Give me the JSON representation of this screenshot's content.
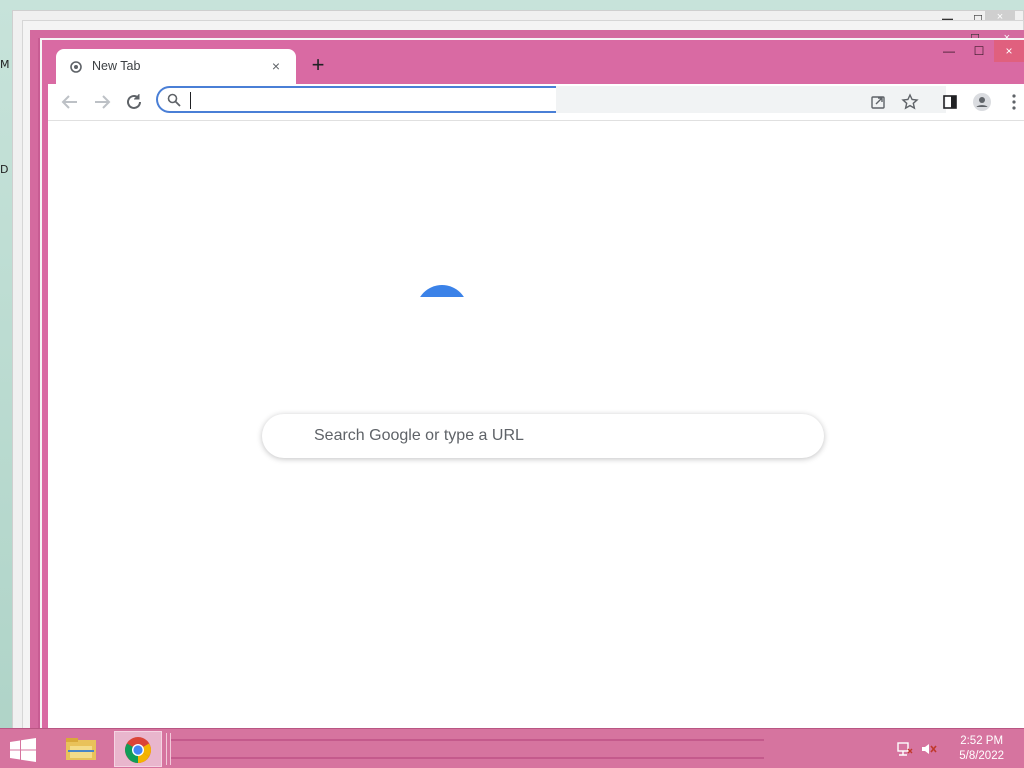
{
  "desktop": {
    "fragment_top": "M",
    "fragment_mid": "D"
  },
  "browser": {
    "tab": {
      "title": "New Tab",
      "close_symbol": "×"
    },
    "new_tab_symbol": "+",
    "window_controls": {
      "minimize": "—",
      "maximize": "☐",
      "close": "×"
    },
    "omnibox": {
      "value": "",
      "placeholder": ""
    },
    "ntp": {
      "search_placeholder": "Search Google or type a URL"
    },
    "colors": {
      "frame": "#d96aa3",
      "accent": "#4a7fd6",
      "spinner": "#3b82e8"
    }
  },
  "taskbar": {
    "clock_time": "2:52 PM",
    "clock_date": "5/8/2022",
    "icons": [
      "windows-start-icon",
      "file-explorer-icon",
      "chrome-icon",
      "network-icon",
      "volume-muted-icon"
    ]
  }
}
